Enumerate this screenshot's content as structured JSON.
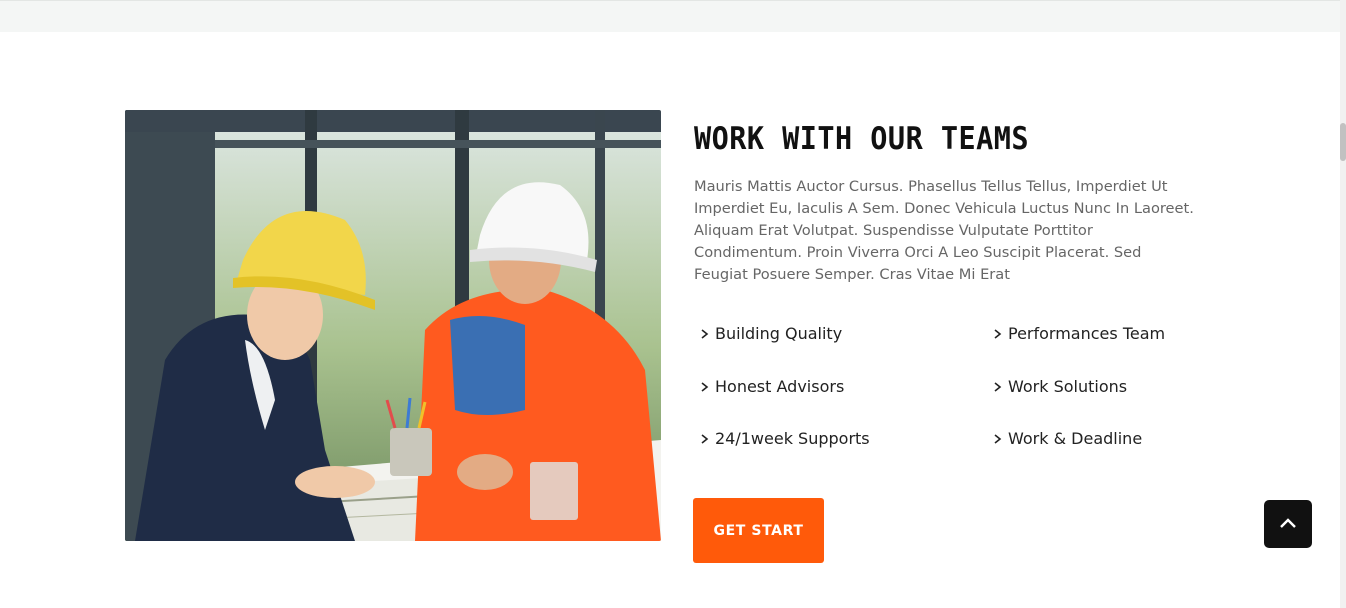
{
  "section": {
    "title": "WORK WITH OUR TEAMS",
    "description": "Mauris Mattis Auctor Cursus. Phasellus Tellus Tellus, Imperdiet Ut Imperdiet Eu, Iaculis A Sem. Donec Vehicula Luctus Nunc In Laoreet. Aliquam Erat Volutpat. Suspendisse Vulputate Porttitor Condimentum. Proin Viverra Orci A Leo Suscipit Placerat. Sed Feugiat Posuere Semper. Cras Vitae Mi Erat",
    "image_alt": "Two engineers in hard hats reviewing blueprints",
    "features": [
      {
        "label": "Building Quality",
        "icon": "chevron-right-icon"
      },
      {
        "label": "Performances Team",
        "icon": "chevron-right-icon"
      },
      {
        "label": "Honest Advisors",
        "icon": "chevron-right-icon"
      },
      {
        "label": "Work Solutions",
        "icon": "chevron-right-icon"
      },
      {
        "label": "24/1week Supports",
        "icon": "chevron-right-icon"
      },
      {
        "label": "Work & Deadline",
        "icon": "chevron-right-icon"
      }
    ],
    "cta_label": "GET START"
  },
  "back_to_top": {
    "icon": "chevron-up-icon"
  },
  "colors": {
    "accent": "#ff5a0a",
    "title": "#111111",
    "text": "#666666",
    "band": "#f4f6f5"
  }
}
